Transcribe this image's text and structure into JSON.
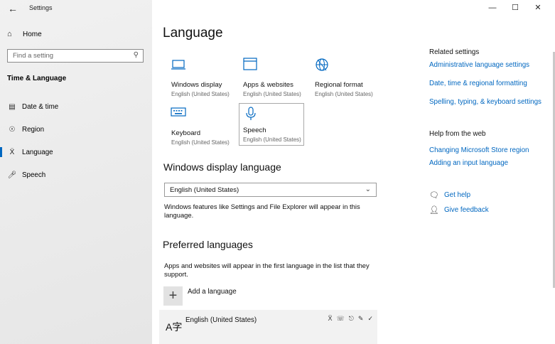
{
  "window": {
    "title": "Settings",
    "controls": [
      "—",
      "☐",
      "✕"
    ]
  },
  "sidebar": {
    "home_label": "Home",
    "search_placeholder": "Find a setting",
    "section_title": "Time & Language",
    "items": [
      {
        "label": "Date & time",
        "icon": "calendar-icon"
      },
      {
        "label": "Region",
        "icon": "globe-icon"
      },
      {
        "label": "Language",
        "icon": "language-icon",
        "active": true
      },
      {
        "label": "Speech",
        "icon": "microphone-icon"
      }
    ]
  },
  "main": {
    "title": "Language",
    "tiles": [
      {
        "title": "Windows display",
        "subtitle": "English (United States)",
        "icon": "laptop-icon"
      },
      {
        "title": "Apps & websites",
        "subtitle": "English (United States)",
        "icon": "window-icon"
      },
      {
        "title": "Regional format",
        "subtitle": "English (United States)",
        "icon": "globe-icon"
      },
      {
        "title": "Keyboard",
        "subtitle": "English (United States)",
        "icon": "keyboard-icon"
      },
      {
        "title": "Speech",
        "subtitle": "English (United States)",
        "icon": "microphone-icon",
        "selected": true
      }
    ],
    "display_language": {
      "heading": "Windows display language",
      "selected_value": "English (United States)",
      "description": "Windows features like Settings and File Explorer will appear in this language."
    },
    "preferred": {
      "heading": "Preferred languages",
      "description": "Apps and websites will appear in the first language in the list that they support.",
      "add_label": "Add a language",
      "languages": [
        {
          "name": "English (United States)"
        }
      ]
    }
  },
  "related": {
    "title": "Related settings",
    "links": [
      "Administrative language settings",
      "Date, time & regional formatting",
      "Spelling, typing, & keyboard settings"
    ]
  },
  "help": {
    "title": "Help from the web",
    "links": [
      "Changing Microsoft Store region",
      "Adding an input language"
    ],
    "get_help": "Get help",
    "give_feedback": "Give feedback"
  },
  "colors": {
    "accent": "#0067c0",
    "sidebar_bg": "#ececec"
  }
}
